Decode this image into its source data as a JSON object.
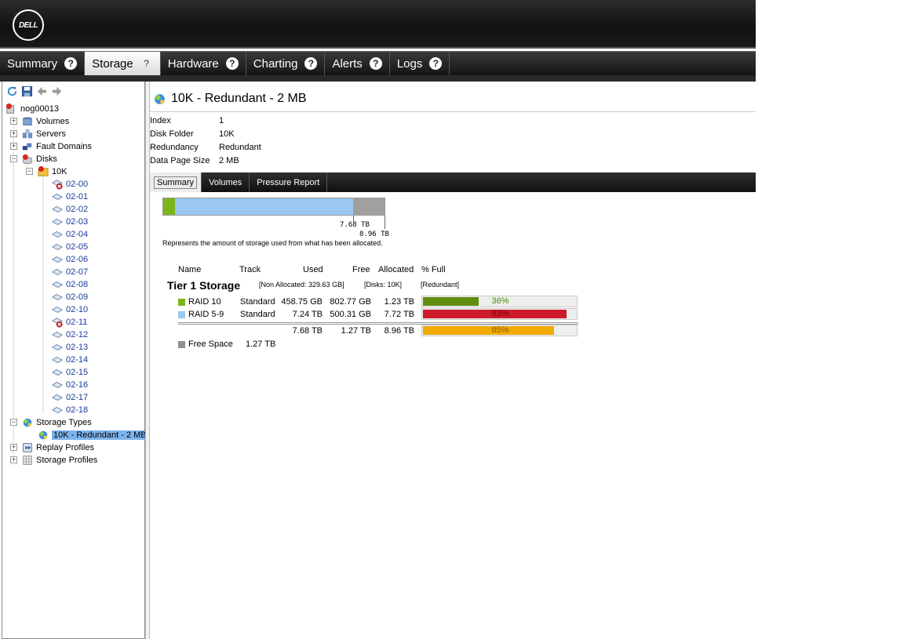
{
  "brand": {
    "logo_text": "DELL"
  },
  "nav": {
    "tabs": [
      {
        "label": "Summary"
      },
      {
        "label": "Storage"
      },
      {
        "label": "Hardware"
      },
      {
        "label": "Charting"
      },
      {
        "label": "Alerts"
      },
      {
        "label": "Logs"
      }
    ],
    "active": "Storage",
    "help_glyph": "?"
  },
  "tree": {
    "root": "nog00013",
    "volumes": "Volumes",
    "servers": "Servers",
    "fault_domains": "Fault Domains",
    "disks": "Disks",
    "disk_folder": "10K",
    "disk_items": [
      {
        "label": "02-00",
        "status": "error"
      },
      {
        "label": "02-01",
        "status": "ok"
      },
      {
        "label": "02-02",
        "status": "ok"
      },
      {
        "label": "02-03",
        "status": "ok"
      },
      {
        "label": "02-04",
        "status": "ok"
      },
      {
        "label": "02-05",
        "status": "ok"
      },
      {
        "label": "02-06",
        "status": "ok"
      },
      {
        "label": "02-07",
        "status": "ok"
      },
      {
        "label": "02-08",
        "status": "ok"
      },
      {
        "label": "02-09",
        "status": "ok"
      },
      {
        "label": "02-10",
        "status": "ok"
      },
      {
        "label": "02-11",
        "status": "error"
      },
      {
        "label": "02-12",
        "status": "ok"
      },
      {
        "label": "02-13",
        "status": "ok"
      },
      {
        "label": "02-14",
        "status": "ok"
      },
      {
        "label": "02-15",
        "status": "ok"
      },
      {
        "label": "02-16",
        "status": "ok"
      },
      {
        "label": "02-17",
        "status": "ok"
      },
      {
        "label": "02-18",
        "status": "ok"
      }
    ],
    "storage_types": "Storage Types",
    "storage_type_selected": "10K - Redundant - 2 MB",
    "replay_profiles": "Replay Profiles",
    "storage_profiles": "Storage Profiles"
  },
  "detail": {
    "title": "10K - Redundant - 2 MB",
    "properties": [
      {
        "key": "Index",
        "value": "1"
      },
      {
        "key": "Disk Folder",
        "value": "10K"
      },
      {
        "key": "Redundancy",
        "value": "Redundant"
      },
      {
        "key": "Data Page Size",
        "value": "2 MB"
      }
    ],
    "subtabs": [
      "Summary",
      "Volumes",
      "Pressure Report"
    ],
    "active_subtab": "Summary"
  },
  "usage_bar": {
    "used_label": "7.68 TB",
    "allocated_label": "8.96 TB",
    "note": "Represents the amount of storage used from what has been allocated.",
    "segments": [
      {
        "name": "RAID 10",
        "fraction": 0.052,
        "color": "#7ab51d"
      },
      {
        "name": "RAID 5-9",
        "fraction": 0.805,
        "color": "#9ac8f0"
      },
      {
        "name": "Free Space",
        "fraction": 0.143,
        "color": "#a0a0a0"
      }
    ]
  },
  "table": {
    "headers": {
      "name": "Name",
      "track": "Track",
      "used": "Used",
      "free": "Free",
      "allocated": "Allocated",
      "pct_full": "% Full"
    },
    "tier": {
      "title": "Tier 1 Storage",
      "non_allocated": "[Non Allocated: 329.63 GB]",
      "disks": "[Disks: 10K]",
      "redundancy": "[Redundant]"
    },
    "rows": [
      {
        "name": "RAID 10",
        "track": "Standard",
        "used": "458.75 GB",
        "free": "802.77 GB",
        "allocated": "1.23 TB",
        "pct_full": "36%",
        "pct": 36,
        "swatch": "#7ab51d",
        "bar_color": "#5f8e10",
        "text_color": "#4c8a00"
      },
      {
        "name": "RAID 5-9",
        "track": "Standard",
        "used": "7.24 TB",
        "free": "500.31 GB",
        "allocated": "7.72 TB",
        "pct_full": "93%",
        "pct": 93,
        "swatch": "#9ac8f0",
        "bar_color": "#cc1a2a",
        "text_color": "#7a0000"
      }
    ],
    "totals": {
      "used": "7.68 TB",
      "free": "1.27 TB",
      "allocated": "8.96 TB",
      "pct_full": "85%",
      "pct": 85,
      "bar_color": "#f1aa00",
      "text_color": "#8a5a00"
    },
    "free_space": {
      "label": "Free Space",
      "value": "1.27 TB",
      "swatch": "#8f8f8f"
    }
  }
}
